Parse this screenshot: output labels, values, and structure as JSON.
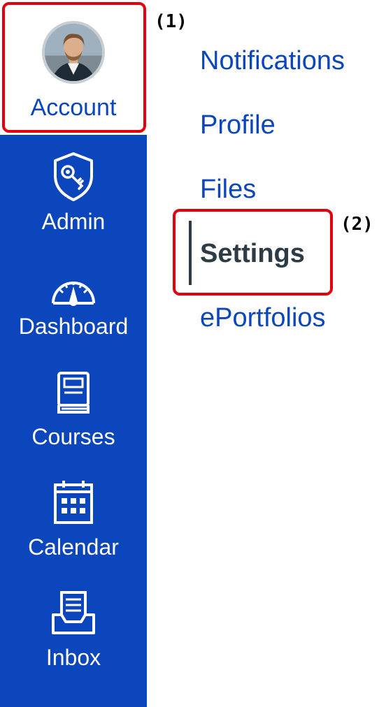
{
  "global_nav": {
    "account": {
      "label": "Account"
    },
    "items": [
      {
        "label": "Admin",
        "icon": "admin-shield-key-icon"
      },
      {
        "label": "Dashboard",
        "icon": "dashboard-gauge-icon"
      },
      {
        "label": "Courses",
        "icon": "courses-book-icon"
      },
      {
        "label": "Calendar",
        "icon": "calendar-icon"
      },
      {
        "label": "Inbox",
        "icon": "inbox-icon"
      }
    ],
    "colors": {
      "background": "#0b46bd",
      "text": "#ffffff"
    }
  },
  "account_menu": {
    "links": [
      {
        "label": "Notifications"
      },
      {
        "label": "Profile"
      },
      {
        "label": "Files"
      },
      {
        "label": "Settings",
        "active": true
      },
      {
        "label": "ePortfolios"
      }
    ],
    "colors": {
      "link": "#0b46bd",
      "active": "#2d3b45"
    }
  },
  "annotations": [
    {
      "label": "(1)",
      "color": "#e3000f"
    },
    {
      "label": "(2)",
      "color": "#e3000f"
    }
  ]
}
